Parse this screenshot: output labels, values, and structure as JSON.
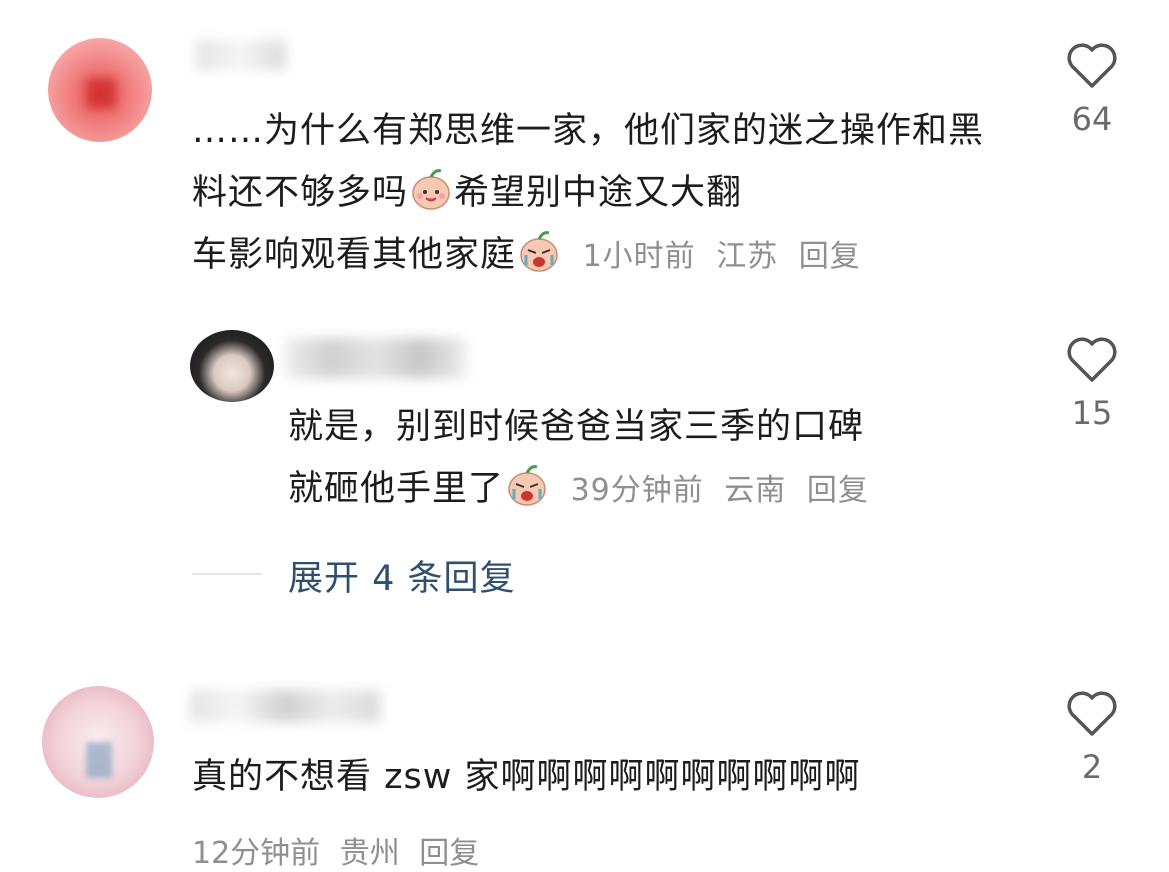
{
  "comments": [
    {
      "text": "……为什么有郑思维一家，他们家的迷之操作和黑料还不够多吗",
      "text_mid": "希望别中途又大翻",
      "text_line3": "车影响观看其他家庭",
      "time": "1小时前",
      "location": "江苏",
      "reply_label": "回复",
      "likes": "64",
      "emoji1": "smiling-peach-emoji",
      "emoji2": "crying-peach-emoji"
    },
    {
      "text_line1": "就是，别到时候爸爸当家三季的口碑",
      "text_line2": "就砸他手里了",
      "time": "39分钟前",
      "location": "云南",
      "reply_label": "回复",
      "likes": "15",
      "emoji": "crying-peach-emoji"
    },
    {
      "text": "真的不想看 zsw 家啊啊啊啊啊啊啊啊啊啊",
      "time": "12分钟前",
      "location": "贵州",
      "reply_label": "回复",
      "likes": "2"
    }
  ],
  "expand_replies": "展开 4 条回复",
  "colors": {
    "text": "#1c1c1c",
    "meta": "#8f8f8f",
    "expand": "#2f4f6f"
  }
}
